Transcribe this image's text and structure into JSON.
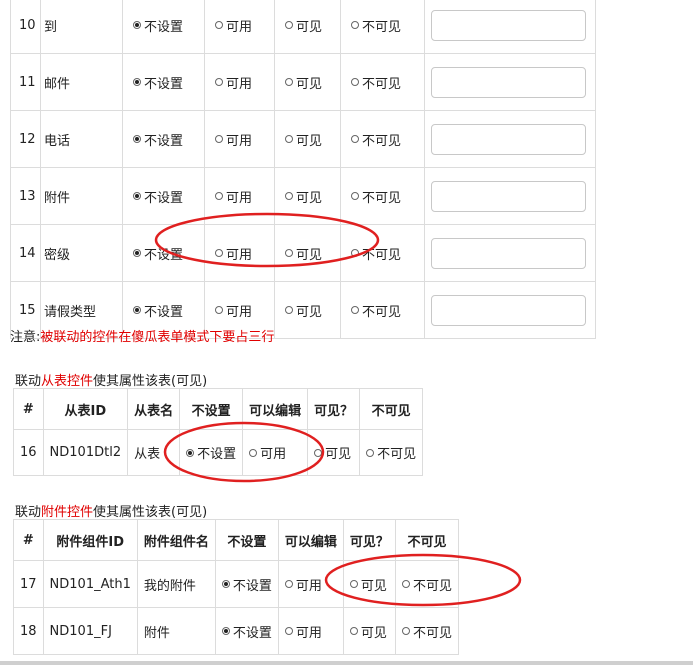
{
  "field_rows": [
    {
      "num": "10",
      "name": "到",
      "selected": 0
    },
    {
      "num": "11",
      "name": "邮件",
      "selected": 0
    },
    {
      "num": "12",
      "name": "电话",
      "selected": 0
    },
    {
      "num": "13",
      "name": "附件",
      "selected": 0
    },
    {
      "num": "14",
      "name": "密级",
      "selected": 0
    },
    {
      "num": "15",
      "name": "请假类型",
      "selected": 0
    }
  ],
  "options": [
    "不设置",
    "可用",
    "可见",
    "不可见"
  ],
  "note": {
    "prefix": "注意:",
    "text": "被联动的控件在傻瓜表单模式下要占三行"
  },
  "section_subtable": {
    "caption_prefix": "联动",
    "caption_link": "从表控件",
    "caption_suffix": "使其属性该表(可见)",
    "headers": [
      "#",
      "从表ID",
      "从表名",
      "不设置",
      "可以编辑",
      "可见？",
      "不可见"
    ],
    "rows": [
      {
        "num": "16",
        "id": "ND101Dtl2",
        "name": "从表",
        "selected": 0
      }
    ]
  },
  "section_attachment": {
    "caption_prefix": "联动",
    "caption_link": "附件控件",
    "caption_suffix": "使其属性该表(可见)",
    "headers": [
      "#",
      "附件组件ID",
      "附件组件名",
      "不设置",
      "可以编辑",
      "可见？",
      "不可见"
    ],
    "rows": [
      {
        "num": "17",
        "id": "ND101_Ath1",
        "name": "我的附件",
        "selected": 0
      },
      {
        "num": "18",
        "id": "ND101_FJ",
        "name": "附件",
        "selected": 0
      }
    ]
  },
  "annotation_color": "#e02020"
}
